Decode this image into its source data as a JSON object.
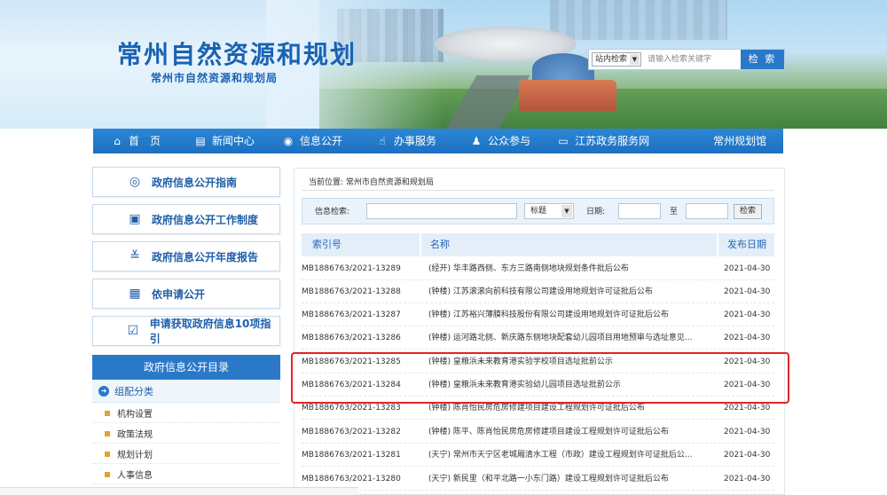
{
  "header": {
    "title": "常州自然资源和规划",
    "subtitle": "常州市自然资源和规划局",
    "search": {
      "scope": "站内检索",
      "placeholder": "请输入检索关键字",
      "button": "检 索"
    }
  },
  "nav": {
    "items": [
      {
        "label": "首　页",
        "icon": "home-icon"
      },
      {
        "label": "新闻中心",
        "icon": "news-icon"
      },
      {
        "label": "信息公开",
        "icon": "globe-icon"
      },
      {
        "label": "办事服务",
        "icon": "thumbs-up-icon"
      },
      {
        "label": "公众参与",
        "icon": "person-icon"
      },
      {
        "label": "江苏政务服务网",
        "icon": "monitor-icon"
      },
      {
        "label": "常州规划馆",
        "icon": ""
      }
    ]
  },
  "sidebar": {
    "buttons": [
      {
        "label": "政府信息公开指南",
        "icon": "compass-icon"
      },
      {
        "label": "政府信息公开工作制度",
        "icon": "document-icon"
      },
      {
        "label": "政府信息公开年度报告",
        "icon": "chart-icon"
      },
      {
        "label": "依申请公开",
        "icon": "form-icon"
      },
      {
        "label": "申请获取政府信息10项指引",
        "icon": "checklist-icon"
      }
    ],
    "directory_title": "政府信息公开目录",
    "directory_section": "组配分类",
    "directory_items": [
      "机构设置",
      "政策法规",
      "规划计划",
      "人事信息"
    ]
  },
  "main": {
    "breadcrumb": "当前位置:  常州市自然资源和规划局",
    "filter": {
      "label": "信息检索:",
      "field_select": "标题",
      "date_label": "日期:",
      "to_label": "至",
      "button": "检索"
    },
    "columns": {
      "index": "索引号",
      "name": "名称",
      "date": "发布日期"
    },
    "rows": [
      {
        "index": "MB1886763/2021-13289",
        "name": "(经开) 华丰路西侧、东方三路南侧地块规划条件批后公布",
        "date": "2021-04-30"
      },
      {
        "index": "MB1886763/2021-13288",
        "name": "(钟楼) 江苏滚滚向前科技有限公司建设用地规划许可证批后公布",
        "date": "2021-04-30"
      },
      {
        "index": "MB1886763/2021-13287",
        "name": "(钟楼) 江苏裕兴薄膜科技股份有限公司建设用地规划许可证批后公布",
        "date": "2021-04-30"
      },
      {
        "index": "MB1886763/2021-13286",
        "name": "(钟楼) 运河路北侧、新庆路东侧地块配套幼儿园项目用地预审与选址意见...",
        "date": "2021-04-30"
      },
      {
        "index": "MB1886763/2021-13285",
        "name": "(钟楼) 皇粮浜未来教育港实验学校项目选址批前公示",
        "date": "2021-04-30"
      },
      {
        "index": "MB1886763/2021-13284",
        "name": "(钟楼) 皇粮浜未来教育港实验幼儿园项目选址批前公示",
        "date": "2021-04-30"
      },
      {
        "index": "MB1886763/2021-13283",
        "name": "(钟楼) 陈肖怡民房危房修建项目建设工程规划许可证批后公布",
        "date": "2021-04-30"
      },
      {
        "index": "MB1886763/2021-13282",
        "name": "(钟楼) 陈平、陈肖怡民房危房修建项目建设工程规划许可证批后公布",
        "date": "2021-04-30"
      },
      {
        "index": "MB1886763/2021-13281",
        "name": "(天宁) 常州市天宁区老城厢清水工程（市政）建设工程规划许可证批后公...",
        "date": "2021-04-30"
      },
      {
        "index": "MB1886763/2021-13280",
        "name": "(天宁) 新民里（和平北路一小东门路）建设工程规划许可证批后公布",
        "date": "2021-04-30"
      }
    ]
  },
  "colors": {
    "accent": "#2a79c9",
    "nav": "#1e6fbf",
    "title": "#1a62b4",
    "highlight": "#e02424"
  }
}
